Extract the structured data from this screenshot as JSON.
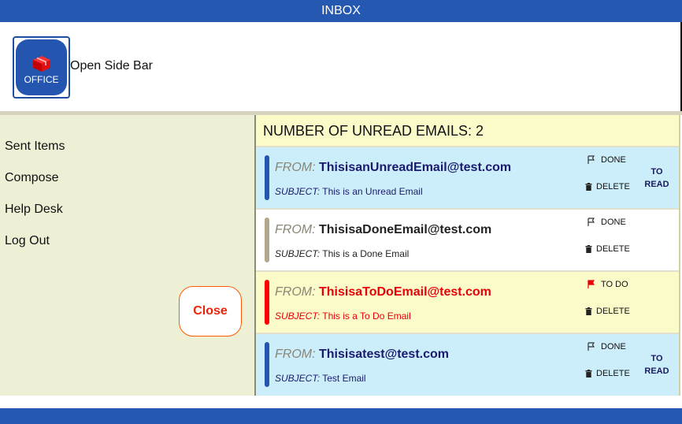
{
  "titlebar": {
    "title": "INBOX"
  },
  "header": {
    "office_label": "OFFICE",
    "open_sidebar": "Open Side Bar"
  },
  "sidebar": {
    "items": [
      {
        "label": "Sent Items"
      },
      {
        "label": "Compose"
      },
      {
        "label": "Help Desk"
      },
      {
        "label": "Log Out"
      }
    ],
    "close_label": "Close"
  },
  "main": {
    "unread_label": "NUMBER OF UNREAD EMAILS: 2",
    "from_label": "FROM:",
    "subject_label": "SUBJECT:",
    "delete_label": "DELETE",
    "emails": [
      {
        "from": "ThisisanUnreadEmail@test.com",
        "subject": "This is an Unread Email",
        "status": "DONE",
        "read_action": "TO READ",
        "bg": "#cceefa",
        "bar": "#2456b0",
        "addr_color": "#1a1a6e",
        "subject_color": "#1a1a6e",
        "flag_color": "#333333"
      },
      {
        "from": "ThisisaDoneEmail@test.com",
        "subject": "This is a Done Email",
        "status": "DONE",
        "read_action": "",
        "bg": "#ffffff",
        "bar": "#b2a98c",
        "addr_color": "#222222",
        "subject_color": "#222222",
        "flag_color": "#333333"
      },
      {
        "from": "ThisisaToDoEmail@test.com",
        "subject": "This is a To Do Email",
        "status": "TO DO",
        "read_action": "",
        "bg": "#fafbc8",
        "bar": "#ff0000",
        "addr_color": "#e8000a",
        "subject_color": "#e8000a",
        "flag_color": "#e8000a"
      },
      {
        "from": "Thisisatest@test.com",
        "subject": "Test Email",
        "status": "DONE",
        "read_action": "TO READ",
        "bg": "#cceefa",
        "bar": "#2456b0",
        "addr_color": "#1a1a6e",
        "subject_color": "#1a1a6e",
        "flag_color": "#333333"
      }
    ]
  },
  "colors": {
    "accent": "#2558b1",
    "sidebar_bg": "#eef0d6",
    "main_bg": "#fafbc8",
    "close_text": "#e8250a"
  },
  "icons": {
    "office": "office-cube-icon",
    "flag": "flag-icon",
    "trash": "trash-icon"
  }
}
